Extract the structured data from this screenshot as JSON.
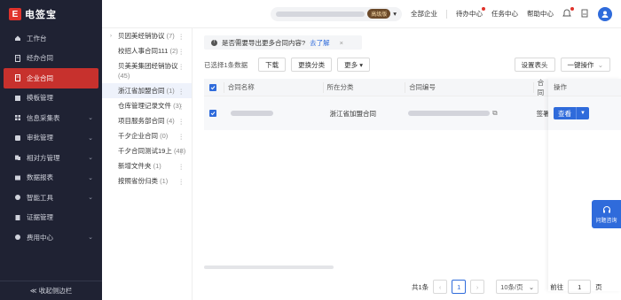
{
  "app": {
    "name": "电签宝",
    "logo_letter": "E"
  },
  "sidebar": {
    "items": [
      {
        "label": "工作台",
        "icon": "home-icon"
      },
      {
        "label": "经办合同",
        "icon": "document-icon"
      },
      {
        "label": "企业合同",
        "icon": "document-icon",
        "active": true
      },
      {
        "label": "模板管理",
        "icon": "template-icon"
      },
      {
        "label": "信息采集表",
        "icon": "grid-icon",
        "expandable": true
      },
      {
        "label": "审批管理",
        "icon": "approval-icon",
        "expandable": true
      },
      {
        "label": "相对方管理",
        "icon": "contacts-icon",
        "expandable": true
      },
      {
        "label": "数据报表",
        "icon": "report-icon",
        "expandable": true
      },
      {
        "label": "智能工具",
        "icon": "tool-icon",
        "expandable": true
      },
      {
        "label": "证据管理",
        "icon": "evidence-icon"
      },
      {
        "label": "费用中心",
        "icon": "coin-icon",
        "expandable": true
      }
    ],
    "collapse_label": "≪ 收起侧边栏"
  },
  "topbar": {
    "badge": "高级版",
    "enterprise": "全部企业",
    "todo": "待办中心",
    "tasks": "任务中心",
    "help": "帮助中心"
  },
  "folders": [
    {
      "name": "贝因美经销协议",
      "count": "(7)"
    },
    {
      "name": "校招人事合同111",
      "count": "(2)"
    },
    {
      "name": "贝美美集团经销协议",
      "count": "(45)"
    },
    {
      "name": "浙江省加盟合同",
      "count": "(1)",
      "active": true
    },
    {
      "name": "仓库管理记录文件",
      "count": "(3)"
    },
    {
      "name": "项目服务部合同",
      "count": "(4)"
    },
    {
      "name": "千夕企业合同",
      "count": "(0)"
    },
    {
      "name": "千夕合同测试19上",
      "count": "(48)"
    },
    {
      "name": "新增文件夹",
      "count": "(1)"
    },
    {
      "name": "按照省份归类",
      "count": "(1)"
    }
  ],
  "banner": {
    "text": "是否需要导出更多合同内容?",
    "link": "去了解",
    "close": "×"
  },
  "toolbar": {
    "selected": "已选择1条数据",
    "download": "下载",
    "change_category": "更换分类",
    "more": "更多",
    "set_header": "设置表头",
    "one_click": "一键操作"
  },
  "table": {
    "headers": [
      "合同名称",
      "所在分类",
      "合同编号",
      "合同",
      "操作"
    ],
    "row": {
      "category": "浙江省加盟合同",
      "status": "签署",
      "action": "查看"
    }
  },
  "pager": {
    "total": "共1条",
    "current": "1",
    "size": "10条/页",
    "goto": "前往",
    "goto_value": "1",
    "page_unit": "页"
  },
  "support": {
    "label": "问题咨询"
  },
  "colors": {
    "brand": "#c7312d",
    "accent": "#2f6bdb",
    "sidebar_bg": "#1f2233"
  }
}
